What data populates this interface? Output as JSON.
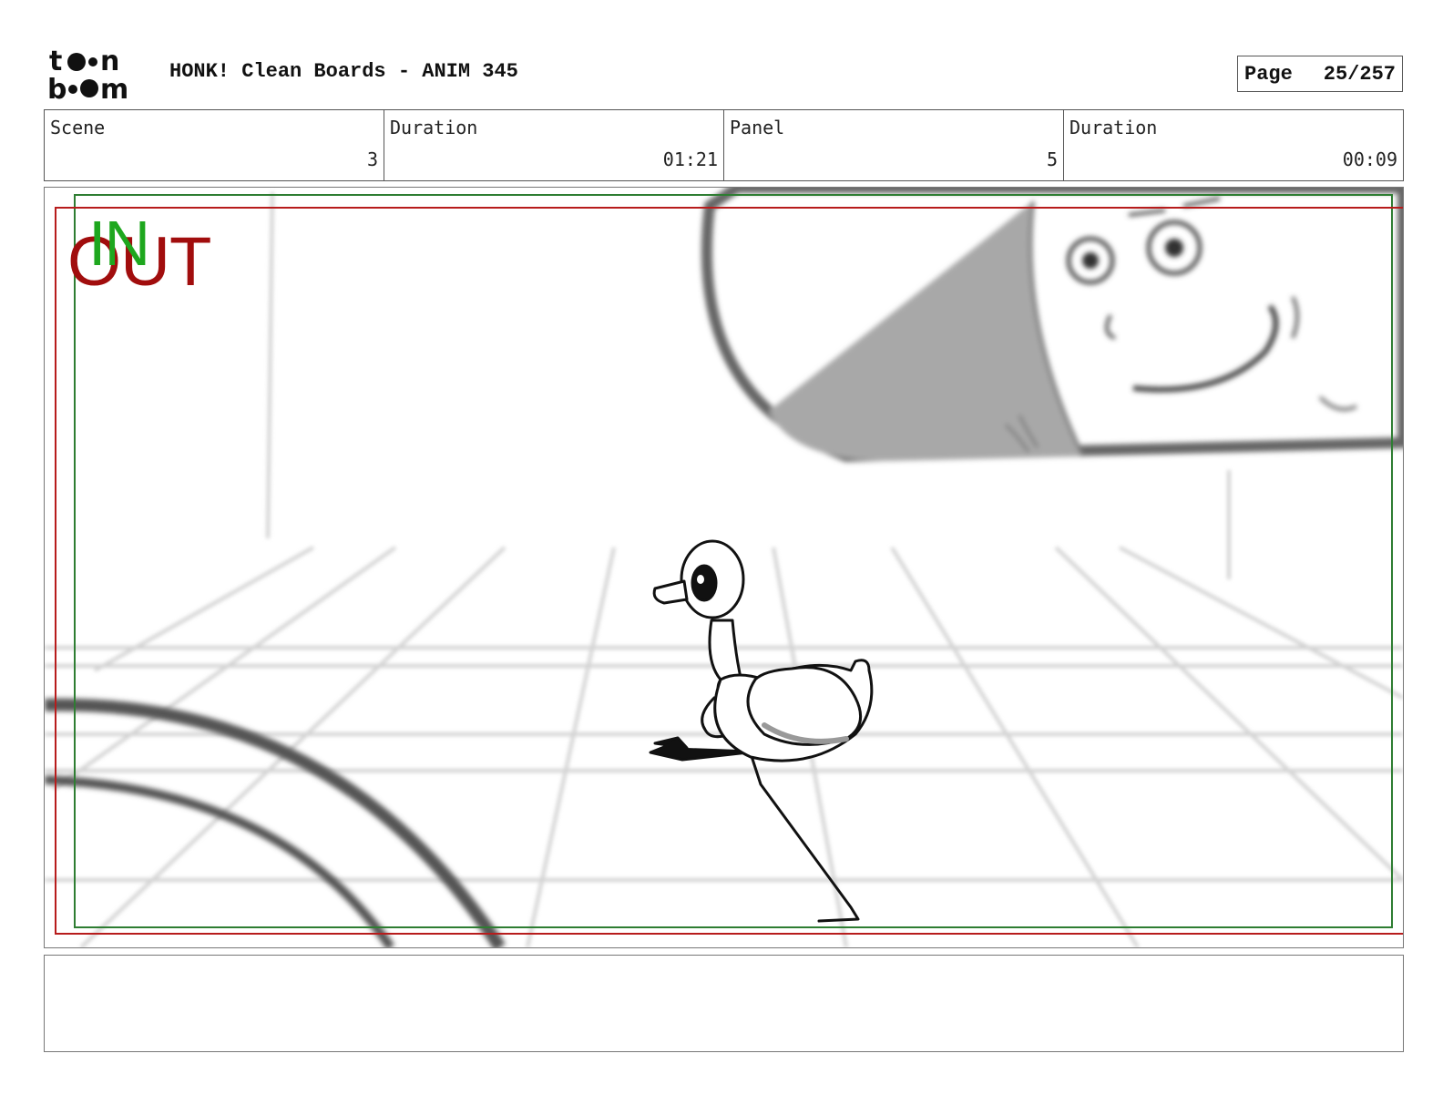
{
  "header": {
    "logo_text": "toon boom",
    "title": "HONK! Clean Boards - ANIM 345",
    "page_label": "Page",
    "page_value": "25/257"
  },
  "info": {
    "scene_label": "Scene",
    "scene_value": "3",
    "scene_duration_label": "Duration",
    "scene_duration_value": "01:21",
    "panel_label": "Panel",
    "panel_value": "5",
    "panel_duration_label": "Duration",
    "panel_duration_value": "00:09"
  },
  "panel": {
    "in_marker": "IN",
    "out_marker": "OUT",
    "colors": {
      "in": "#1ea71e",
      "out": "#a10d0d",
      "safe_green": "#2e7d32",
      "safe_red": "#b71c1c"
    }
  },
  "notes": {
    "text": ""
  }
}
